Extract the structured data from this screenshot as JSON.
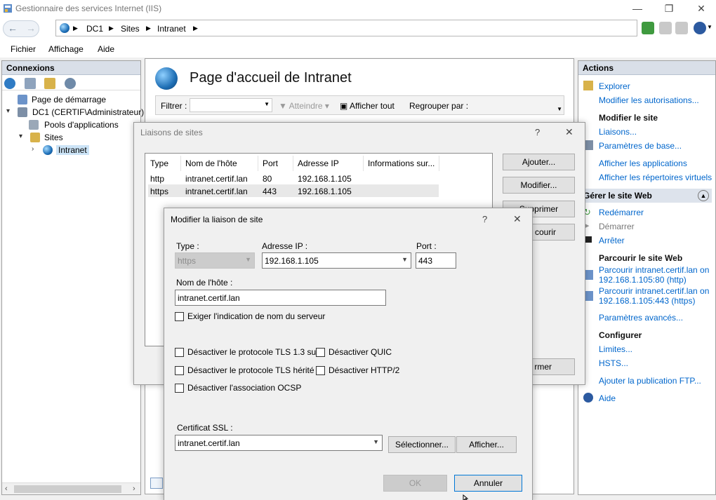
{
  "window": {
    "title": "Gestionnaire des services Internet (IIS)",
    "controls": {
      "minimize": "—",
      "restore": "❐",
      "close": "✕"
    }
  },
  "address": {
    "crumbs": [
      "DC1",
      "Sites",
      "Intranet"
    ]
  },
  "menu": [
    "Fichier",
    "Affichage",
    "Aide"
  ],
  "connections": {
    "header": "Connexions",
    "tree": [
      {
        "label": "Page de démarrage",
        "expander": ""
      },
      {
        "label": "DC1 (CERTIF\\Administrateur)",
        "expander": "▾"
      },
      {
        "label": "Pools d'applications",
        "expander": ""
      },
      {
        "label": "Sites",
        "expander": "▾"
      },
      {
        "label": "Intranet",
        "expander": "›"
      }
    ]
  },
  "center": {
    "title": "Page d'accueil de Intranet",
    "filter_label": "Filtrer :",
    "goto_label": "Atteindre",
    "show_all_label": "Afficher tout",
    "group_by_label": "Regrouper par :"
  },
  "actions": {
    "header": "Actions",
    "explore": "Explorer",
    "edit_permissions": "Modifier les autorisations...",
    "edit_site_head": "Modifier le site",
    "bindings": "Liaisons...",
    "basic_settings": "Paramètres de base...",
    "view_apps": "Afficher les applications",
    "view_vdirs": "Afficher les répertoires virtuels",
    "manage_site": "Gérer le site Web",
    "restart": "Redémarrer",
    "start": "Démarrer",
    "stop": "Arrêter",
    "browse_head": "Parcourir le site Web",
    "browse_http_1": "Parcourir intranet.certif.lan on",
    "browse_http_2": "192.168.1.105:80 (http)",
    "browse_https_1": "Parcourir intranet.certif.lan on",
    "browse_https_2": "192.168.1.105:443 (https)",
    "advanced": "Paramètres avancés...",
    "configure_head": "Configurer",
    "limits": "Limites...",
    "hsts": "HSTS...",
    "ftp": "Ajouter la publication FTP...",
    "help": "Aide"
  },
  "bindings_dialog": {
    "title": "Liaisons de sites",
    "help": "?",
    "close": "✕",
    "columns": [
      "Type",
      "Nom de l'hôte",
      "Port",
      "Adresse IP",
      "Informations sur..."
    ],
    "rows": [
      [
        "http",
        "intranet.certif.lan",
        "80",
        "192.168.1.105"
      ],
      [
        "https",
        "intranet.certif.lan",
        "443",
        "192.168.1.105"
      ]
    ],
    "buttons": {
      "add": "Ajouter...",
      "edit": "Modifier...",
      "remove_partial": "Supprimer",
      "browse_partial": "courir",
      "close_partial": "rmer"
    }
  },
  "edit_dialog": {
    "title": "Modifier la liaison de site",
    "help": "?",
    "close": "✕",
    "type_label": "Type :",
    "type_value": "https",
    "ip_label": "Adresse IP :",
    "ip_value": "192.168.1.105",
    "port_label": "Port :",
    "port_value": "443",
    "host_label": "Nom de l'hôte :",
    "host_value": "intranet.certif.lan",
    "sni_label": "Exiger l'indication de nom du serveur",
    "tls13_label": "Désactiver le protocole TLS 1.3 sur",
    "quic_label": "Désactiver QUIC",
    "legacy_label": "Désactiver le protocole TLS hérité",
    "http2_label": "Désactiver HTTP/2",
    "ocsp_label": "Désactiver l'association OCSP",
    "ssl_label": "Certificat SSL :",
    "ssl_value": "intranet.certif.lan",
    "select_btn": "Sélectionner...",
    "view_btn": "Afficher...",
    "ok_btn": "OK",
    "cancel_btn": "Annuler"
  }
}
